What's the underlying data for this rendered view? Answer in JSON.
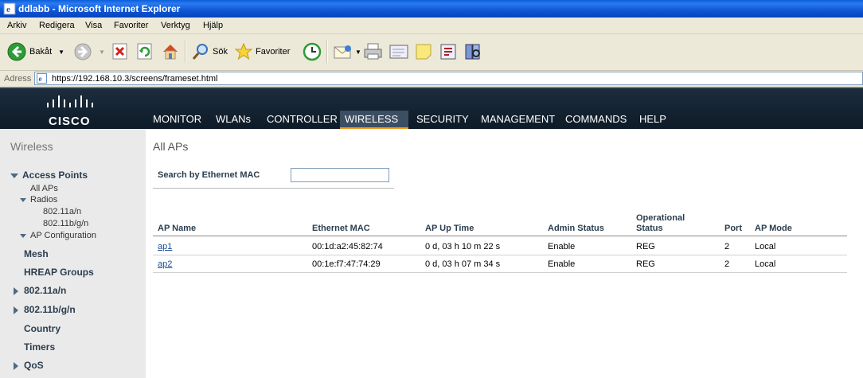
{
  "window": {
    "title": "ddlabb - Microsoft Internet Explorer"
  },
  "menu": [
    "Arkiv",
    "Redigera",
    "Visa",
    "Favoriter",
    "Verktyg",
    "Hjälp"
  ],
  "toolbar": {
    "back_label": "Bakåt",
    "search_label": "Sök",
    "favorites_label": "Favoriter"
  },
  "address": {
    "label": "Adress",
    "url": "https://192.168.10.3/screens/frameset.html"
  },
  "brand": {
    "logo_text": "CISCO",
    "accent": "#f39a1e"
  },
  "nav": [
    {
      "label": "MONITOR"
    },
    {
      "label": "WLANs"
    },
    {
      "label": "CONTROLLER"
    },
    {
      "label": "WIRELESS",
      "active": true
    },
    {
      "label": "SECURITY"
    },
    {
      "label": "MANAGEMENT"
    },
    {
      "label": "COMMANDS"
    },
    {
      "label": "HELP"
    }
  ],
  "sidebar": {
    "title": "Wireless",
    "access_points": "Access Points",
    "all_aps": "All APs",
    "radios": "Radios",
    "radio_a": "802.11a/n",
    "radio_b": "802.11b/g/n",
    "ap_config": "AP Configuration",
    "mesh": "Mesh",
    "hreap": "HREAP Groups",
    "r80211a": "802.11a/n",
    "r80211b": "802.11b/g/n",
    "country": "Country",
    "timers": "Timers",
    "qos": "QoS"
  },
  "page": {
    "title": "All APs",
    "search_label": "Search by Ethernet MAC",
    "search_value": ""
  },
  "table": {
    "headers": {
      "ap_name": "AP Name",
      "eth_mac": "Ethernet MAC",
      "uptime": "AP Up Time",
      "admin": "Admin Status",
      "oper1": "Operational",
      "oper2": "Status",
      "port": "Port",
      "mode": "AP Mode"
    },
    "rows": [
      {
        "name": "ap1",
        "mac": "00:1d:a2:45:82:74",
        "uptime": "0 d, 03 h 10 m 22 s",
        "admin": "Enable",
        "oper": "REG",
        "port": "2",
        "mode": "Local"
      },
      {
        "name": "ap2",
        "mac": "00:1e:f7:47:74:29",
        "uptime": "0 d, 03 h 07 m 34 s",
        "admin": "Enable",
        "oper": "REG",
        "port": "2",
        "mode": "Local"
      }
    ]
  }
}
